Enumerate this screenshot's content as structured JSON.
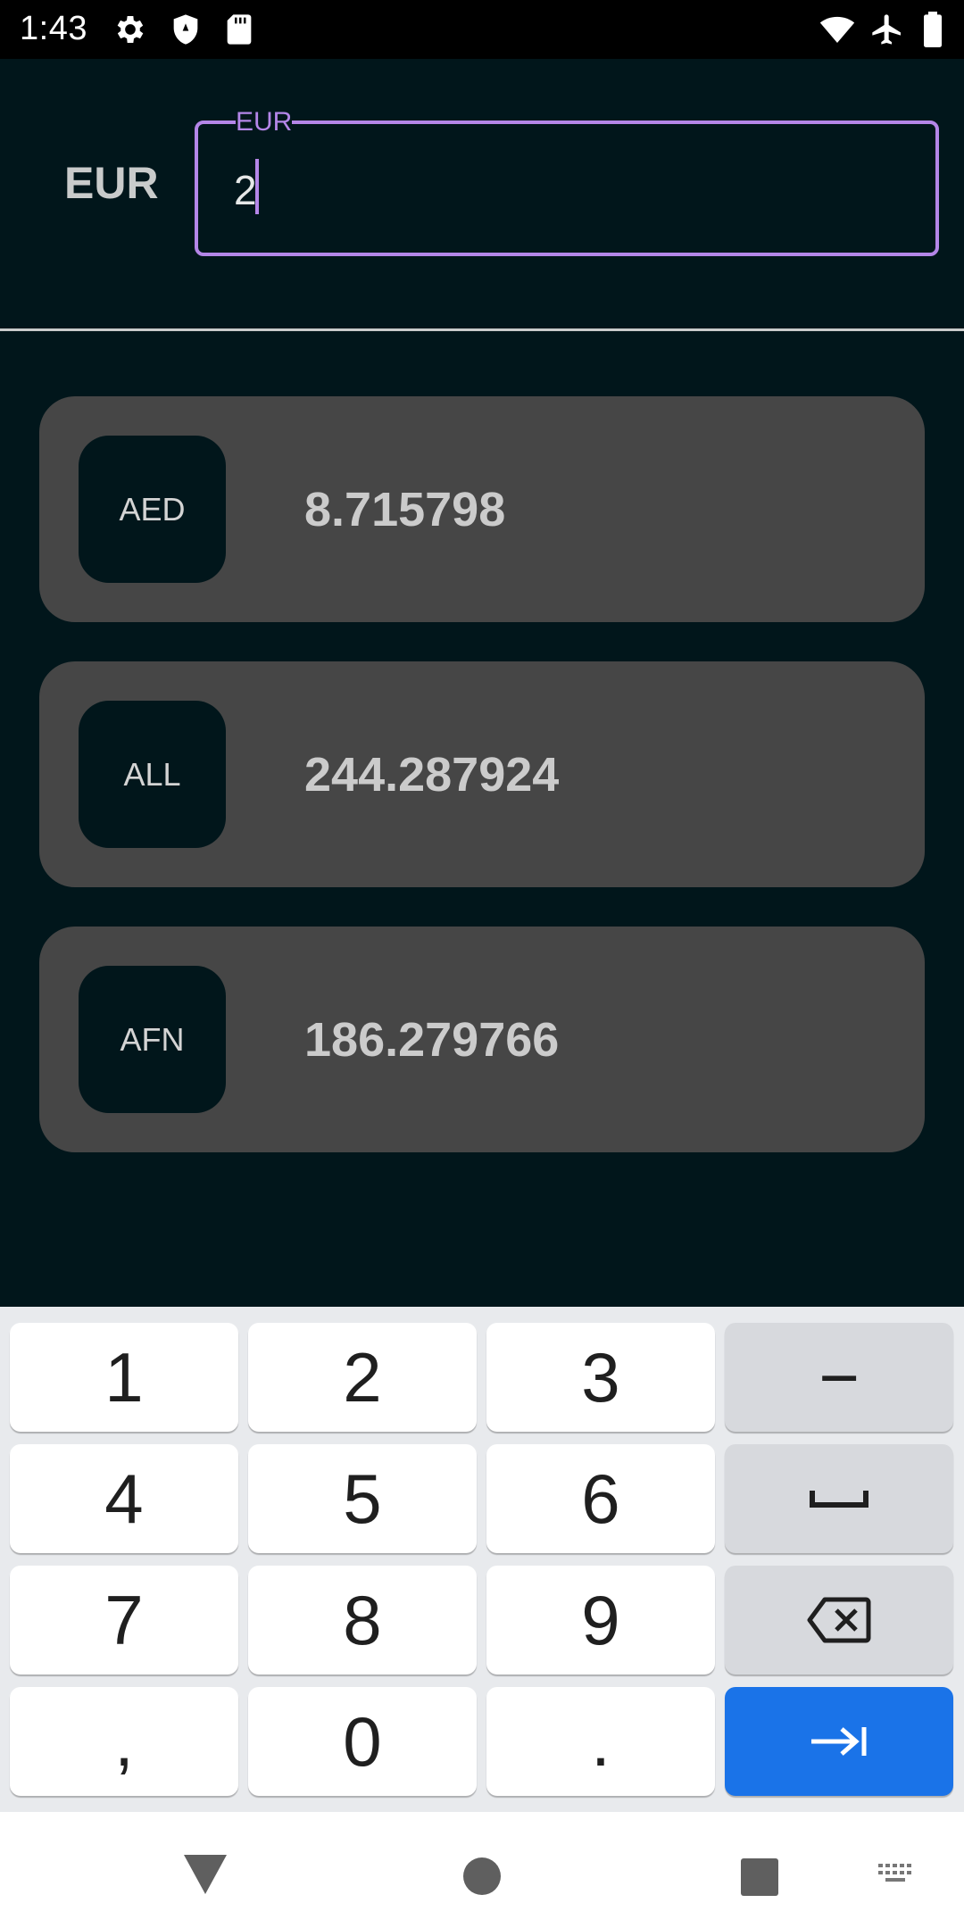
{
  "status_bar": {
    "time": "1:43",
    "icons": [
      "gear-icon",
      "shield-icon",
      "sd-card-icon",
      "wifi-icon",
      "airplane-icon",
      "battery-icon"
    ]
  },
  "converter": {
    "base_currency": "EUR",
    "input_label": "EUR",
    "input_value": "2"
  },
  "results": [
    {
      "code": "AED",
      "value": "8.715798"
    },
    {
      "code": "ALL",
      "value": "244.287924"
    },
    {
      "code": "AFN",
      "value": "186.279766"
    }
  ],
  "keyboard": {
    "rows": [
      [
        "1",
        "2",
        "3",
        "−"
      ],
      [
        "4",
        "5",
        "6",
        "space-icon"
      ],
      [
        "7",
        "8",
        "9",
        "backspace-icon"
      ],
      [
        ",",
        "0",
        ".",
        "tab-next-icon"
      ]
    ]
  },
  "nav_bar": {
    "icons": [
      "back-icon",
      "home-icon",
      "recents-icon",
      "keyboard-switch-icon"
    ]
  },
  "colors": {
    "background": "#01161b",
    "card": "#464646",
    "accent": "#b486e8",
    "enter_key": "#1a73e8"
  }
}
